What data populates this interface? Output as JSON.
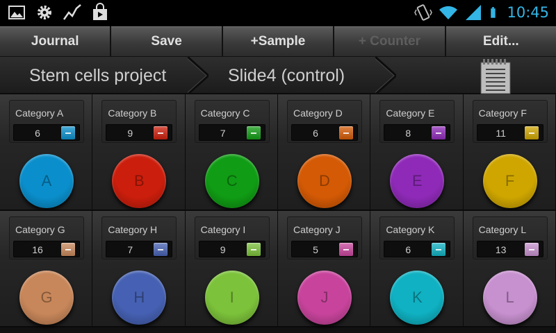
{
  "status_bar": {
    "time": "10:45",
    "left_icons": [
      "gallery-icon",
      "settings-gear-icon",
      "chart-trend-icon",
      "play-store-icon"
    ],
    "right_icons": [
      "vibrate-icon",
      "wifi-icon",
      "signal-icon",
      "battery-icon"
    ],
    "time_color": "#33b5e5"
  },
  "action_bar": {
    "buttons": [
      {
        "label": "Journal",
        "enabled": true
      },
      {
        "label": "Save",
        "enabled": true
      },
      {
        "label": "+Sample",
        "enabled": true
      },
      {
        "label": "+ Counter",
        "enabled": false
      },
      {
        "label": "Edit...",
        "enabled": true
      }
    ]
  },
  "breadcrumb": {
    "items": [
      "Stem cells project",
      "Slide4 (control)"
    ],
    "notes_icon": "notepad-icon"
  },
  "counters": [
    {
      "category": "Category A",
      "count": "6",
      "letter": "A",
      "color": "#0a8fcc"
    },
    {
      "category": "Category B",
      "count": "9",
      "letter": "B",
      "color": "#cc1e0c"
    },
    {
      "category": "Category C",
      "count": "7",
      "letter": "C",
      "color": "#109c14"
    },
    {
      "category": "Category D",
      "count": "6",
      "letter": "D",
      "color": "#d45a05"
    },
    {
      "category": "Category E",
      "count": "8",
      "letter": "E",
      "color": "#8f2ab8"
    },
    {
      "category": "Category F",
      "count": "11",
      "letter": "F",
      "color": "#cfa600"
    },
    {
      "category": "Category G",
      "count": "16",
      "letter": "G",
      "color": "#c8875a"
    },
    {
      "category": "Category H",
      "count": "7",
      "letter": "H",
      "color": "#4661b3"
    },
    {
      "category": "Category I",
      "count": "9",
      "letter": "I",
      "color": "#7cc23a"
    },
    {
      "category": "Category J",
      "count": "5",
      "letter": "J",
      "color": "#c8449c"
    },
    {
      "category": "Category K",
      "count": "6",
      "letter": "K",
      "color": "#0fb1c2"
    },
    {
      "category": "Category L",
      "count": "13",
      "letter": "L",
      "color": "#c790cf"
    }
  ]
}
